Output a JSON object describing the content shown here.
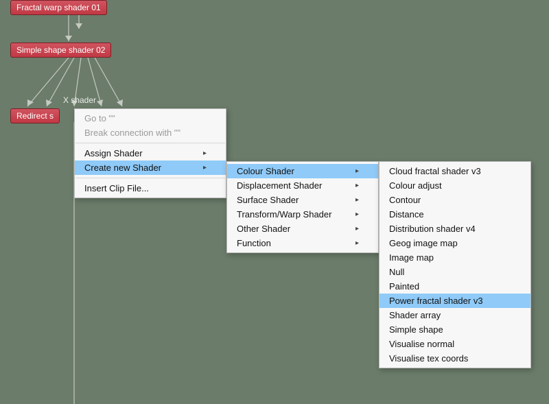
{
  "colors": {
    "canvas_bg": "#6b7c6a",
    "node_fill_top": "#d0545f",
    "node_fill_bottom": "#c03944",
    "menu_bg": "#f7f7f7",
    "menu_highlight": "#8fcaf8",
    "wire": "#c5cac3"
  },
  "nodes": {
    "fractal_warp": {
      "label": "Fractal warp shader 01"
    },
    "simple_shape": {
      "label": "Simple shape shader 02"
    },
    "redirect": {
      "label": "Redirect s"
    },
    "x_shader_label": {
      "label": "X shader"
    }
  },
  "menu1": {
    "goto": "Go to \"\"",
    "break": "Break connection with \"\"",
    "assign": "Assign Shader",
    "create": "Create new Shader",
    "clip": "Insert Clip File..."
  },
  "menu2": {
    "colour": "Colour Shader",
    "displacement": "Displacement Shader",
    "surface": "Surface Shader",
    "transform": "Transform/Warp Shader",
    "other": "Other Shader",
    "function": "Function"
  },
  "menu3": {
    "items": [
      "Cloud fractal shader v3",
      "Colour adjust",
      "Contour",
      "Distance",
      "Distribution shader v4",
      "Geog image map",
      "Image map",
      "Null",
      "Painted",
      "Power fractal shader v3",
      "Shader array",
      "Simple shape",
      "Visualise normal",
      "Visualise tex coords"
    ],
    "highlighted_index": 9
  }
}
